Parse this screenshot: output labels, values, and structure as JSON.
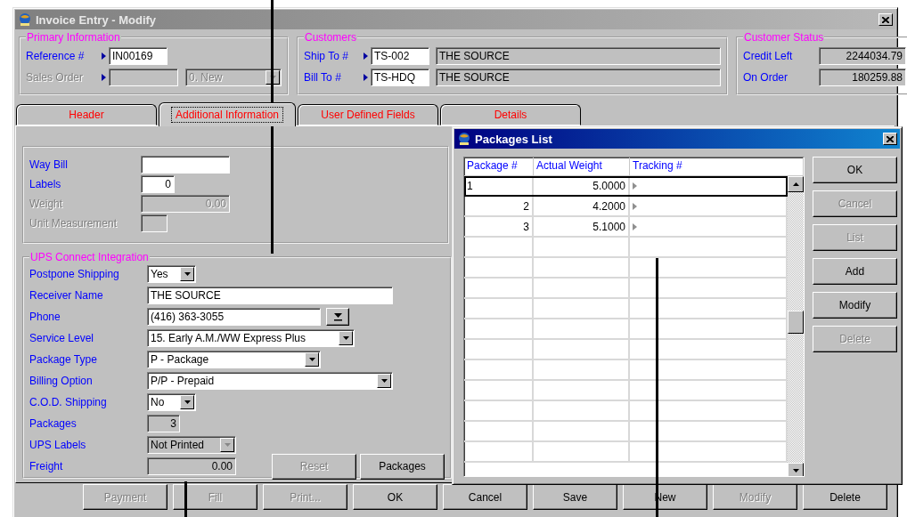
{
  "window": {
    "title": "Invoice Entry - Modify"
  },
  "primary_information": {
    "title": "Primary Information",
    "reference": {
      "label": "Reference #",
      "value": "IN00169"
    },
    "sales_order": {
      "label": "Sales Order",
      "status": "0. New",
      "disabled": true
    }
  },
  "customers": {
    "title": "Customers",
    "rows": [
      {
        "label": "Ship To #",
        "code": "TS-002",
        "name": "THE SOURCE"
      },
      {
        "label": "Bill To #",
        "code": "TS-HDQ",
        "name": "THE SOURCE"
      }
    ]
  },
  "customer_status": {
    "title": "Customer Status",
    "rows": [
      {
        "label": "Credit Left",
        "value": "2244034.79"
      },
      {
        "label": "On Order",
        "value": "180259.88"
      }
    ]
  },
  "tabs": [
    {
      "label": "Header",
      "selected": false
    },
    {
      "label": "Additional Information",
      "selected": true
    },
    {
      "label": "User Defined Fields",
      "selected": false
    },
    {
      "label": "Details",
      "selected": false
    }
  ],
  "shipping_fields": [
    {
      "label": "Way Bill",
      "disabled": false
    },
    {
      "label": "Labels",
      "value": "0",
      "disabled": false
    },
    {
      "label": "Weight",
      "value": "0.00",
      "disabled": true
    },
    {
      "label": "Unit Measurement",
      "disabled": true
    }
  ],
  "ups_connect": {
    "title": "UPS Connect Integration",
    "fields": [
      {
        "label": "Postpone Shipping",
        "kind": "combo",
        "value": "Yes",
        "disabled": false
      },
      {
        "label": "Receiver Name",
        "kind": "text",
        "value": "THE SOURCE",
        "disabled": false
      },
      {
        "label": "Phone",
        "kind": "lookup",
        "value": "(416) 363-3055",
        "disabled": false
      },
      {
        "label": "Service Level",
        "kind": "combo",
        "value": "15. Early A.M./WW Express Plus",
        "disabled": false
      },
      {
        "label": "Package Type",
        "kind": "combo",
        "value": "P - Package",
        "disabled": false
      },
      {
        "label": "Billing Option",
        "kind": "combo",
        "value": "P/P - Prepaid",
        "disabled": false
      },
      {
        "label": "C.O.D. Shipping",
        "kind": "combo",
        "value": "No",
        "disabled": false
      },
      {
        "label": "Packages",
        "kind": "readonly",
        "value": "3",
        "disabled": false
      },
      {
        "label": "UPS Labels",
        "kind": "combo",
        "value": "Not Printed",
        "disabled": true
      },
      {
        "label": "Freight",
        "kind": "readonly",
        "value": "0.00",
        "disabled": false
      }
    ],
    "buttons": [
      {
        "label": "Reset",
        "disabled": true
      },
      {
        "label": "Packages",
        "disabled": false
      }
    ]
  },
  "buttons": [
    {
      "label": "Payment",
      "disabled": true
    },
    {
      "label": "Fill",
      "disabled": true
    },
    {
      "label": "Print...",
      "disabled": true
    },
    {
      "label": "OK",
      "disabled": false
    },
    {
      "label": "Cancel",
      "disabled": false
    },
    {
      "label": "Save",
      "disabled": false
    },
    {
      "label": "New",
      "disabled": false
    },
    {
      "label": "Modify",
      "disabled": true
    },
    {
      "label": "Delete",
      "disabled": false
    }
  ],
  "packages_list": {
    "title": "Packages List",
    "columns": [
      "Package #",
      "Actual Weight",
      "Tracking #"
    ],
    "rows": [
      {
        "package": "1",
        "weight": "5.0000",
        "tracking": "",
        "selected": true
      },
      {
        "package": "2",
        "weight": "4.2000",
        "tracking": "",
        "selected": false
      },
      {
        "package": "3",
        "weight": "5.1000",
        "tracking": "",
        "selected": false
      }
    ],
    "buttons": [
      {
        "label": "OK",
        "disabled": false
      },
      {
        "label": "Cancel",
        "disabled": true
      },
      {
        "label": "List",
        "disabled": true
      },
      {
        "label": "Add",
        "disabled": false
      },
      {
        "label": "Modify",
        "disabled": false
      },
      {
        "label": "Delete",
        "disabled": true
      }
    ]
  }
}
